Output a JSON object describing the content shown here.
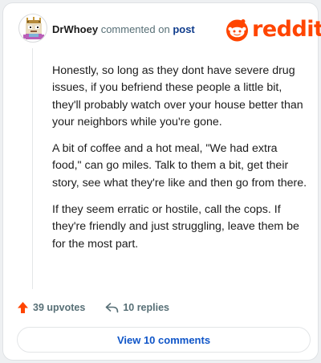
{
  "header": {
    "username": "DrWhoey",
    "action_text": "commented on",
    "target": "post"
  },
  "brand": {
    "name": "reddit",
    "color": "#ff4500",
    "icon": "reddit-snoo-icon"
  },
  "comment": {
    "paragraphs": [
      "Honestly, so long as they dont have severe drug issues, if you befriend these people a little bit, they'll probably watch over your house better than your neighbors while you're gone.",
      "A bit of coffee and a hot meal, \"We had extra food,\" can go miles. Talk to them a bit, get their story, see what they're like and then go from there.",
      "If they seem erratic or hostile, call the cops. If they're friendly and just struggling, leave them be for the most part."
    ]
  },
  "actions": {
    "upvotes_label": "39 upvotes",
    "upvote_icon": "upvote-arrow-icon",
    "replies_label": "10 replies",
    "reply_icon": "reply-arrow-icon"
  },
  "view_comments_label": "View 10 comments",
  "colors": {
    "accent": "#ff4500",
    "link": "#0f55c8",
    "post_link": "#0f3c8c",
    "muted": "#576f76"
  }
}
